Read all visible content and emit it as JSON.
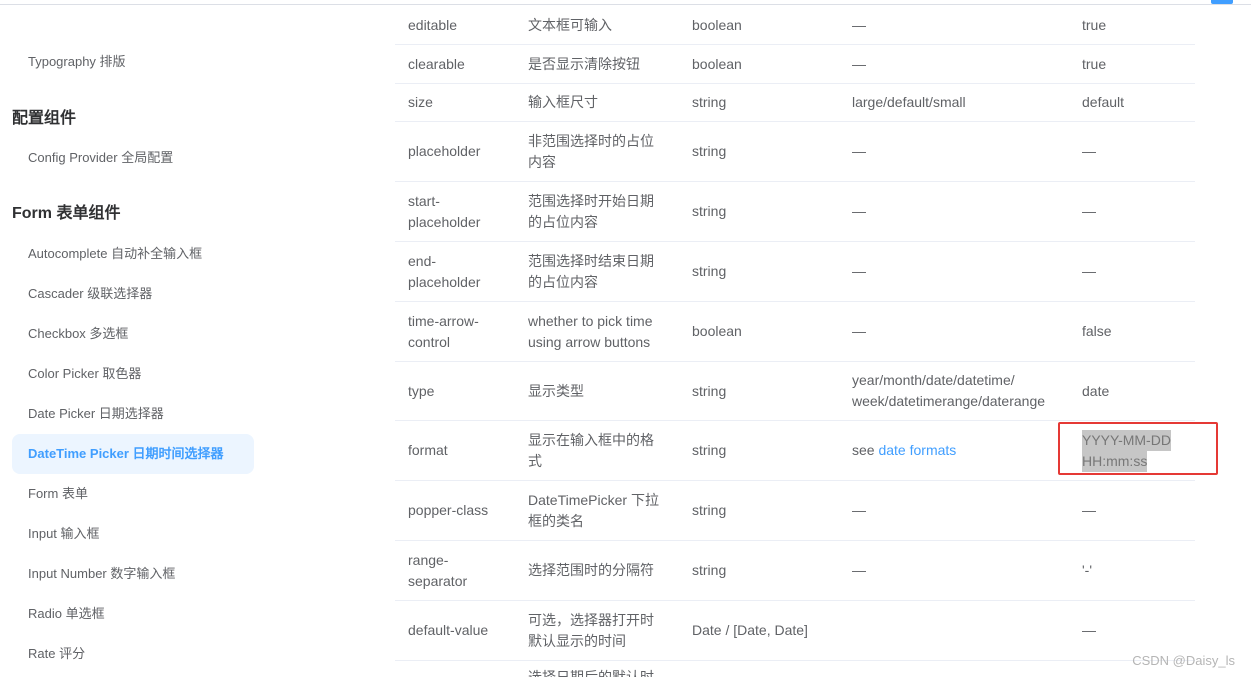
{
  "sidebar": {
    "items": [
      {
        "label": "Typography 排版"
      },
      {
        "label": "配置组件"
      },
      {
        "label": "Config Provider 全局配置"
      },
      {
        "label": "Form 表单组件"
      },
      {
        "label": "Autocomplete 自动补全输入框"
      },
      {
        "label": "Cascader 级联选择器"
      },
      {
        "label": "Checkbox 多选框"
      },
      {
        "label": "Color Picker 取色器"
      },
      {
        "label": "Date Picker 日期选择器"
      },
      {
        "label": "DateTime Picker 日期时间选择器",
        "active": true
      },
      {
        "label": "Form 表单"
      },
      {
        "label": "Input 输入框"
      },
      {
        "label": "Input Number 数字输入框"
      },
      {
        "label": "Radio 单选框"
      },
      {
        "label": "Rate 评分"
      }
    ]
  },
  "table": {
    "rows": [
      [
        "editable",
        "文本框可输入",
        "boolean",
        "—",
        "true"
      ],
      [
        "clearable",
        "是否显示清除按钮",
        "boolean",
        "—",
        "true"
      ],
      [
        "size",
        "输入框尺寸",
        "string",
        "large/default/small",
        "default"
      ],
      [
        "placeholder",
        "非范围选择时的占位内容",
        "string",
        "—",
        "—"
      ],
      [
        "start-placeholder",
        "范围选择时开始日期的占位内容",
        "string",
        "—",
        "—"
      ],
      [
        "end-placeholder",
        "范围选择时结束日期的占位内容",
        "string",
        "—",
        "—"
      ],
      [
        "time-arrow-control",
        "whether to pick time using arrow buttons",
        "boolean",
        "—",
        "false"
      ],
      [
        "type",
        "显示类型",
        "string",
        "year/month/date/datetime/ week/datetimerange/daterange",
        "date"
      ],
      [
        "format",
        "显示在输入框中的格式",
        "string",
        "",
        ""
      ],
      [
        "popper-class",
        "DateTimePicker 下拉框的类名",
        "string",
        "—",
        "—"
      ],
      [
        "range-separator",
        "选择范围时的分隔符",
        "string",
        "—",
        "'-'"
      ],
      [
        "default-value",
        "可选，选择器打开时默认显示的时间",
        "Date / [Date, Date]",
        "",
        "—"
      ],
      [
        "",
        "选择日期后的默认时",
        "",
        "",
        ""
      ]
    ],
    "format_row": {
      "see": "see",
      "link": "date formats",
      "default_line1": "YYYY-MM-DD",
      "default_line2": "HH:mm:ss"
    }
  },
  "watermark": "CSDN @Daisy_ls",
  "colors": {
    "accent": "#409eff",
    "highlight_box": "#e53935",
    "active_bg": "#ecf5ff"
  }
}
